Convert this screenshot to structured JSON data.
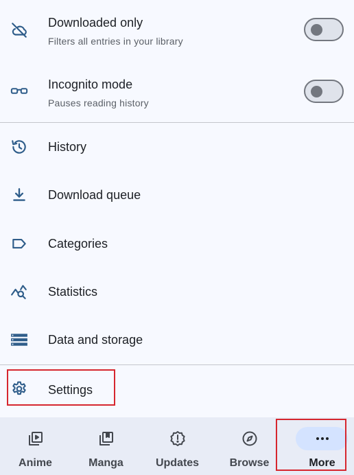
{
  "settings": {
    "downloaded_only": {
      "title": "Downloaded only",
      "subtitle": "Filters all entries in your library",
      "enabled": false,
      "icon": "cloud-off-icon"
    },
    "incognito": {
      "title": "Incognito mode",
      "subtitle": "Pauses reading history",
      "enabled": false,
      "icon": "glasses-icon"
    }
  },
  "menu": {
    "history": "History",
    "download_queue": "Download queue",
    "categories": "Categories",
    "statistics": "Statistics",
    "data_storage": "Data and storage",
    "settings": "Settings"
  },
  "nav": {
    "anime": "Anime",
    "manga": "Manga",
    "updates": "Updates",
    "browse": "Browse",
    "more": "More",
    "selected": "More"
  },
  "colors": {
    "accent": "#2f5d8a",
    "highlight_box": "#d6262e",
    "nav_selected_pill": "#d4e3ff"
  }
}
